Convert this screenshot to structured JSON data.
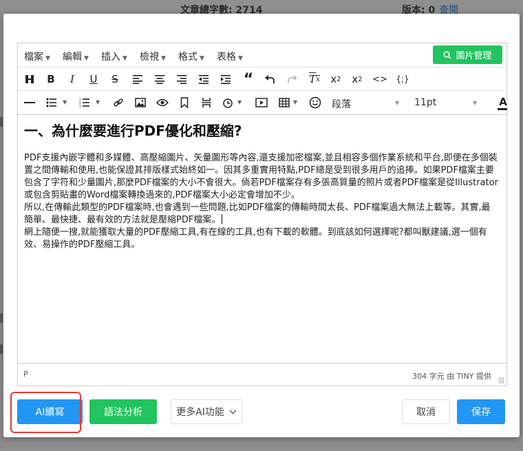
{
  "background": {
    "word_count_label": "文章總字數: 2714",
    "version_label": "版本: 0",
    "version_link": "查閱"
  },
  "menubar": {
    "items": [
      "檔案",
      "編輯",
      "插入",
      "檢視",
      "格式",
      "表格"
    ],
    "image_manage_label": "圖片管理"
  },
  "toolbar": {
    "format_select": "段落",
    "font_size_select": "11pt",
    "font_color_label": "A"
  },
  "content": {
    "heading": "一、為什麼要進行PDF優化和壓縮?",
    "paragraphs": [
      "PDF支援內嵌字體和多媒體、高壓縮圖片、矢量圖形等內容,還支援加密檔案,並且相容多個作業系統和平台,即便在多個裝置之間傳輸和使用,也能保證其排版樣式始終如一。因其多重實用特點,PDF總是受到很多用戶的追捧。如果PDF檔案主要包含了字符和少量圖片,那麼PDF檔案的大小不會很大。倘若PDF檔案存有多張高質量的照片或者PDF檔案是從Illustrator或包含剪貼畫的Word檔案轉換過來的,PDF檔案大小必定會增加不少。",
      "所以,在傳輸此類型的PDF檔案時,也會遇到一些問題,比如PDF檔案的傳輸時間太長、PDF檔案過大無法上載等。其實,最簡單、最快捷、最有效的方法就是壓縮PDF檔案。",
      "網上隨便一搜,就能獲取大量的PDF壓縮工具,有在線的工具,也有下載的軟體。到底該如何選擇呢?都叫獸建議,選一個有效、易操作的PDF壓縮工具。"
    ]
  },
  "status": {
    "path": "P",
    "char_count": "304 字元 由 TINY 提供"
  },
  "buttons": {
    "ai_write": "AI續寫",
    "grammar": "語法分析",
    "more_ai": "更多AI功能",
    "cancel": "取消",
    "save": "保存"
  },
  "icons": {
    "toolbar_row1": [
      "clear-format-icon",
      "bold-icon",
      "italic-icon",
      "underline-icon",
      "strikethrough-icon",
      "align-left-icon",
      "align-center-icon",
      "align-right-icon",
      "outdent-icon",
      "indent-icon",
      "blockquote-icon",
      "undo-icon",
      "redo-icon",
      "remove-format-icon",
      "subscript-icon",
      "superscript-icon",
      "code-icon",
      "code-sample-icon"
    ],
    "toolbar_row2": [
      "horizontal-rule-icon",
      "bullet-list-icon",
      "numbered-list-icon",
      "link-icon",
      "image-icon",
      "preview-icon",
      "bookmark-icon",
      "page-break-icon",
      "clock-icon",
      "media-icon",
      "table-icon",
      "emoticon-icon"
    ]
  },
  "colors": {
    "primary_blue": "#2196f3",
    "green": "#21c45e",
    "highlight_red": "#e53935"
  }
}
